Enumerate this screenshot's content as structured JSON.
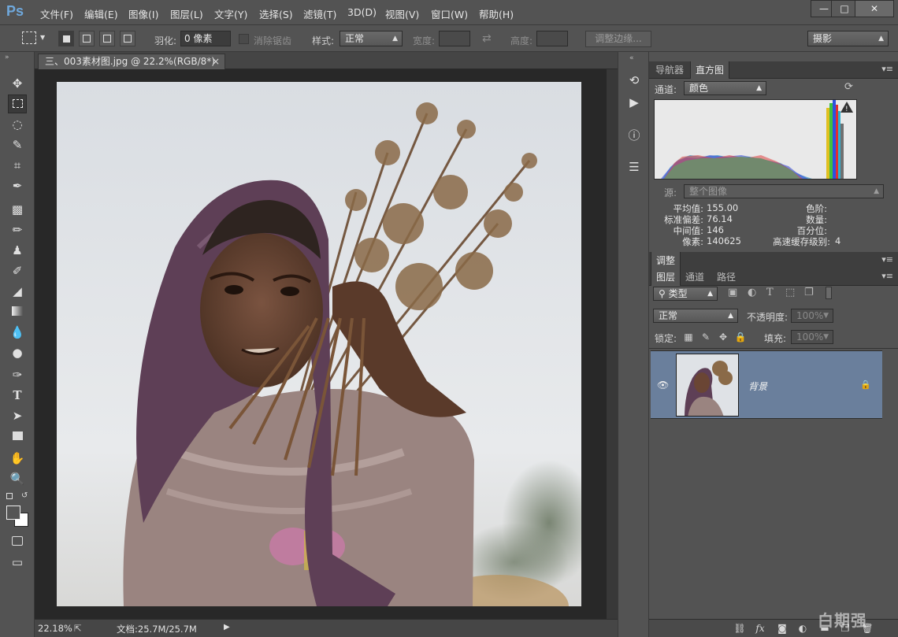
{
  "app": {
    "logo": "Ps"
  },
  "menu": [
    "文件(F)",
    "编辑(E)",
    "图像(I)",
    "图层(L)",
    "文字(Y)",
    "选择(S)",
    "滤镜(T)",
    "3D(D)",
    "视图(V)",
    "窗口(W)",
    "帮助(H)"
  ],
  "window_controls": {
    "minimize": "—",
    "maximize": "□",
    "close": "✕"
  },
  "options_bar": {
    "feather_label": "羽化:",
    "feather_value": "0 像素",
    "antialias_label": "消除锯齿",
    "style_label": "样式:",
    "style_value": "正常",
    "width_label": "宽度:",
    "height_label": "高度:",
    "refine_edge_button": "调整边缘...",
    "workspace_value": "摄影"
  },
  "document": {
    "tab_title": "三、003素材图.jpg @ 22.2%(RGB/8*)",
    "tab_close": "×",
    "zoom": "22.18%",
    "doc_info": "文档:25.7M/25.7M"
  },
  "histogram_panel": {
    "tabs": [
      "导航器",
      "直方图"
    ],
    "active_tab": "直方图",
    "channel_label": "通道:",
    "channel_value": "颜色",
    "source_label": "源:",
    "source_value": "整个图像",
    "stats_left": [
      {
        "label": "平均值:",
        "value": "155.00"
      },
      {
        "label": "标准偏差:",
        "value": "76.14"
      },
      {
        "label": "中间值:",
        "value": "146"
      },
      {
        "label": "像素:",
        "value": "140625"
      }
    ],
    "stats_right": [
      {
        "label": "色阶:",
        "value": ""
      },
      {
        "label": "数量:",
        "value": ""
      },
      {
        "label": "百分位:",
        "value": ""
      },
      {
        "label": "高速缓存级别:",
        "value": "4"
      }
    ]
  },
  "adjust_panel": {
    "tab": "调整"
  },
  "layers_panel": {
    "tabs": [
      "图层",
      "通道",
      "路径"
    ],
    "active_tab": "图层",
    "filter_value": "类型",
    "blend_mode": "正常",
    "opacity_label": "不透明度:",
    "opacity_value": "100%",
    "lock_label": "锁定:",
    "fill_label": "填充:",
    "fill_value": "100%",
    "layers": [
      {
        "name": "背景",
        "locked": true,
        "visible": true
      }
    ]
  },
  "watermark": "白期强",
  "colors": {
    "selected_layer": "#6a7f9c",
    "canvas_bg": "#282828",
    "ui_bg": "#535353"
  }
}
